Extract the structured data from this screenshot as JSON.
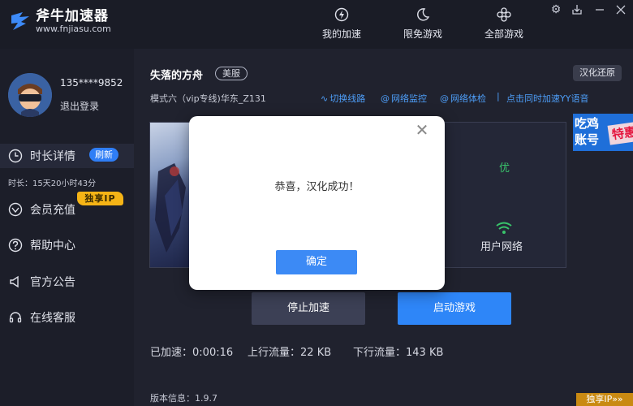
{
  "app": {
    "name": "斧牛加速器",
    "url": "www.fnjiasu.com"
  },
  "nav": {
    "items": [
      {
        "label": "我的加速",
        "icon": "lightning-icon"
      },
      {
        "label": "限免游戏",
        "icon": "moon-icon"
      },
      {
        "label": "全部游戏",
        "icon": "grid-icon"
      }
    ]
  },
  "window_controls": [
    "settings-icon",
    "download-icon",
    "minimize-icon",
    "close-icon"
  ],
  "user": {
    "phone": "135****9852",
    "logout": "退出登录"
  },
  "sidebar": {
    "items": [
      {
        "label": "时长详情",
        "icon": "clock-icon",
        "active": true
      },
      {
        "label": "会员充值",
        "icon": "gem-icon"
      },
      {
        "label": "帮助中心",
        "icon": "question-icon"
      },
      {
        "label": "官方公告",
        "icon": "megaphone-icon"
      },
      {
        "label": "在线客服",
        "icon": "headset-icon"
      }
    ],
    "refresh_badge": "刷新",
    "duration": "时长：15天20小时43分",
    "vip_badge": "独享IP"
  },
  "game": {
    "title": "失落的方舟",
    "region": "美服",
    "restore_button": "汉化还原",
    "mode": "模式六（vip专线)华东_Z131",
    "links": {
      "switch_route": "切换线路",
      "network_monitor": "网络监控",
      "network_check": "网络体检",
      "yy_voice": "点击同时加速YY语音"
    },
    "separator": "|",
    "quality": "优",
    "network_label": "用户网络"
  },
  "promo": {
    "text_top": "吃鸡",
    "text_bottom": "账号",
    "tag": "特惠"
  },
  "actions": {
    "stop": "停止加速",
    "launch": "启动游戏"
  },
  "stats": {
    "accelerated_label": "已加速：",
    "accelerated_value": "0:00:16",
    "upload_label": "上行流量：",
    "upload_value": "22 KB",
    "download_label": "下行流量：",
    "download_value": "143 KB"
  },
  "version": "版本信息：1.9.7",
  "vip_corner": "独享IP»»",
  "modal": {
    "message": "恭喜，汉化成功！",
    "ok": "确定",
    "close_glyph": "✕"
  },
  "colors": {
    "accent": "#2e86f8",
    "link": "#4d9df7",
    "good": "#39c46b",
    "vip": "#f5b416"
  }
}
